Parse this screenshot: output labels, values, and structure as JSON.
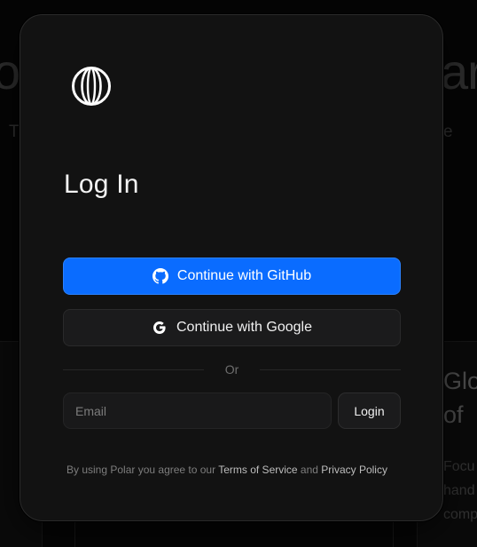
{
  "background": {
    "hero_left": "o",
    "hero_right": "ar",
    "sub_left": "T",
    "sub_right": "e",
    "right_card_title": "Glo of",
    "right_card_text": "Focu hand comp"
  },
  "modal": {
    "logo_icon": "polar-logo-icon",
    "title": "Log In",
    "github_button": {
      "label": "Continue with GitHub",
      "icon": "github-icon"
    },
    "google_button": {
      "label": "Continue with Google",
      "icon": "google-icon"
    },
    "divider_text": "Or",
    "email": {
      "placeholder": "Email",
      "value": ""
    },
    "login_label": "Login",
    "terms": {
      "prefix": "By using Polar you agree to our ",
      "tos_link": "Terms of Service",
      "conjunction": " and ",
      "privacy_link": "Privacy Policy"
    }
  },
  "colors": {
    "github_button_bg": "#0a6cff",
    "modal_bg": "#121212",
    "page_bg": "#050505"
  }
}
